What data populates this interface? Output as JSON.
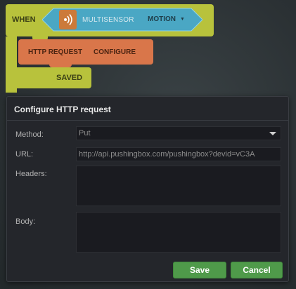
{
  "block": {
    "when_label": "WHEN",
    "sensor_label": "MULTISENSOR",
    "event_value": "MOTION",
    "action_label": "HTTP REQUEST",
    "action_config": "CONFIGURE",
    "saved_label": "SAVED",
    "colors": {
      "when": "#b8c23c",
      "sensor": "#4aa7c4",
      "action": "#d9764a",
      "sensor_icon": "#cc7a3a"
    }
  },
  "dialog": {
    "title": "Configure HTTP request",
    "method_label": "Method:",
    "method_value": "Put",
    "url_label": "URL:",
    "url_value": "http://api.pushingbox.com/pushingbox?devid=vC3A",
    "headers_label": "Headers:",
    "headers_value": "",
    "body_label": "Body:",
    "body_value": "",
    "save_label": "Save",
    "cancel_label": "Cancel",
    "colors": {
      "primary_button": "#4f9a4a"
    }
  }
}
